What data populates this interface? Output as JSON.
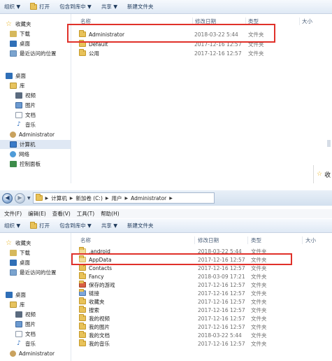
{
  "toolbar": {
    "organize": "组织 ▼",
    "open": "打开",
    "include_in_library": "包含到库中 ▼",
    "share": "共享 ▼",
    "new_folder": "新建文件夹"
  },
  "top_window": {
    "sidebar": {
      "favorites": "收藏夹",
      "downloads": "下载",
      "desktop": "桌面",
      "recent": "最近访问的位置",
      "desktop2": "桌面",
      "libraries": "库",
      "videos": "视频",
      "pictures": "图片",
      "documents": "文档",
      "music": "音乐",
      "administrator": "Administrator",
      "computer": "计算机",
      "network": "网络",
      "control_panel": "控制面板"
    },
    "columns": {
      "name": "名称",
      "date": "修改日期",
      "type": "类型",
      "size": "大小"
    },
    "rows": [
      {
        "name": "Administrator",
        "date": "2018-03-22 5:44",
        "type": "文件夹"
      },
      {
        "name": "Default",
        "date": "2017-12-16 12:57",
        "type": "文件夹"
      },
      {
        "name": "公用",
        "date": "2017-12-16 12:57",
        "type": "文件夹"
      }
    ],
    "status_fragment": "收"
  },
  "bottom_window": {
    "address": {
      "computer": "计算机",
      "drive": "新加卷 (C:)",
      "users": "用户",
      "user": "Administrator"
    },
    "menu": {
      "file": "文件(F)",
      "edit": "编辑(E)",
      "view": "查看(V)",
      "tools": "工具(T)",
      "help": "帮助(H)"
    },
    "sidebar": {
      "favorites": "收藏夹",
      "downloads": "下载",
      "desktop": "桌面",
      "recent": "最近访问的位置",
      "desktop2": "桌面",
      "libraries": "库",
      "videos": "视频",
      "pictures": "图片",
      "documents": "文档",
      "music": "音乐",
      "administrator": "Administrator"
    },
    "columns": {
      "name": "名称",
      "date": "修改日期",
      "type": "类型",
      "size": "大小"
    },
    "rows": [
      {
        "name": ".android",
        "date": "2018-03-22 5:44",
        "type": "文件夹"
      },
      {
        "name": "AppData",
        "date": "2017-12-16 12:57",
        "type": "文件夹"
      },
      {
        "name": "Contacts",
        "date": "2017-12-16 12:57",
        "type": "文件夹"
      },
      {
        "name": "Fancy",
        "date": "2018-03-09 17:21",
        "type": "文件夹"
      },
      {
        "name": "保存的游戏",
        "date": "2017-12-16 12:57",
        "type": "文件夹"
      },
      {
        "name": "链接",
        "date": "2017-12-16 12:57",
        "type": "文件夹"
      },
      {
        "name": "收藏夹",
        "date": "2017-12-16 12:57",
        "type": "文件夹"
      },
      {
        "name": "搜索",
        "date": "2017-12-16 12:57",
        "type": "文件夹"
      },
      {
        "name": "我的视频",
        "date": "2017-12-16 12:57",
        "type": "文件夹"
      },
      {
        "name": "我的图片",
        "date": "2017-12-16 12:57",
        "type": "文件夹"
      },
      {
        "name": "我的文档",
        "date": "2018-03-22 5:44",
        "type": "文件夹"
      },
      {
        "name": "我的音乐",
        "date": "2017-12-16 12:57",
        "type": "文件夹"
      }
    ]
  },
  "colors": {
    "highlight_box": "#e0312a",
    "toolbar_text": "#1e395b",
    "selection": "#dfe8f4"
  }
}
